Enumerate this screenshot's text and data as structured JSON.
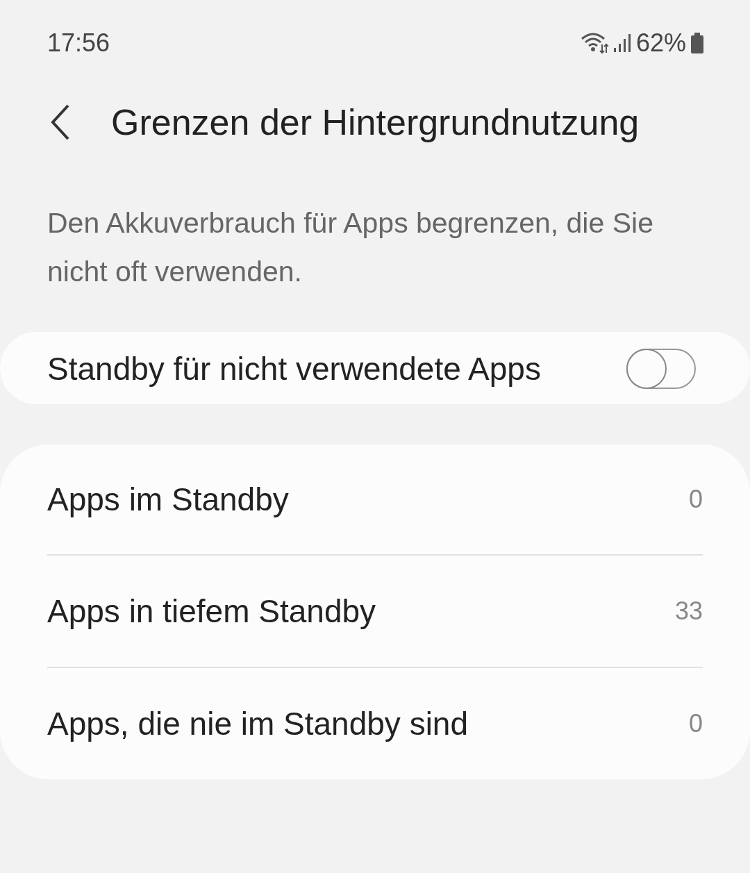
{
  "status_bar": {
    "time": "17:56",
    "battery": "62%"
  },
  "header": {
    "title": "Grenzen der Hintergrundnutzung"
  },
  "description": "Den Akkuverbrauch für Apps begrenzen, die Sie nicht oft verwenden.",
  "standby_toggle": {
    "label": "Standby für nicht verwendete Apps",
    "checked": false
  },
  "list": [
    {
      "label": "Apps im Standby",
      "count": "0"
    },
    {
      "label": "Apps in tiefem Standby",
      "count": "33"
    },
    {
      "label": "Apps, die nie im Standby sind",
      "count": "0"
    }
  ]
}
